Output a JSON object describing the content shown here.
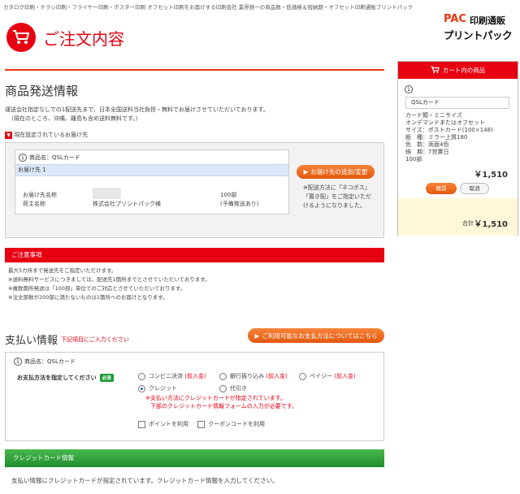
{
  "header": {
    "topline": "カタログ印刷・チラシ印刷・フライヤー印刷・ポスター印刷 オフセット印刷をお届けする印刷会社 業界随一の商品数・低価格＆短納期・オフセット印刷通販プリントパック",
    "logo_text1": "PAC",
    "logo_text2": "印刷通販",
    "logo_text3": "プリントパック",
    "page_title": "ご注文内容"
  },
  "shipping": {
    "heading": "商品発送情報",
    "desc1": "運送会社指定なしでの1配送先まで、日本全国送料当社負担・無料でお届けさせていただいております。",
    "desc2": "（現在のところ、沖縄、離島も含め送料無料です。）",
    "current_label": "現在設定されているお届け先",
    "item_num": "1",
    "item_name": "商品名：QSLカード",
    "dest_label": "お届け先 1",
    "recipient_label": "お届け先名称",
    "shipper_label": "荷主名称",
    "shipper_value": "株式会社プリントパック様",
    "qty": "100部",
    "qty_note": "(予備発送あり)",
    "add_button": "お届け先の追加/変更",
    "side_note1": "※配送方法に「ネコポス」",
    "side_note2": "「置き配」をご指定いただ",
    "side_note3": "けるようになりました。"
  },
  "notice": {
    "bar": "ご注意事項",
    "lines": [
      "最大5カ所まで発送先をご指定いただけます。",
      "※送料無料サービスにつきましては、配送先1箇所までとさせていただいております。",
      "※複数箇所発送は「100部」単位でのご対応とさせていただいております。",
      "※注文部数が200部に満たないものは1箇所へのお届けとなります。"
    ]
  },
  "payment": {
    "heading": "支払い情報",
    "required_note": "下記項目にご入力ください",
    "info_button": "ご利用可能なお支払方法についてはこちら",
    "item_num": "1",
    "item_name": "商品名：QSLカード",
    "prompt": "お支払方法を指定してください",
    "required_badge": "必須",
    "options": {
      "conveni": "コンビニ決済",
      "bank": "銀行振り込み",
      "paidy": "ペイジー",
      "credit": "クレジット",
      "cod": "代引き",
      "prepay": "(前入金)"
    },
    "selected": "クレジット",
    "credit_note1": "※支払い方法にクレジットカードが指定されています。",
    "credit_note2": "下部のクレジットカード情報フォームの入力が必要です。",
    "use_points": "ポイントを利用",
    "use_coupon": "クーポンコードを利用"
  },
  "credit": {
    "bar": "クレジットカード情報",
    "message": "支払い情報にクレジットカードが指定されています。クレジットカード情報を入力してください。"
  },
  "cart": {
    "title": "カート内の商品",
    "item_num": "1",
    "product": "QSLカード",
    "specs": [
      "カード類・ミニサイズ",
      "オンデマンドまたはオフセット",
      "サイズ：ポストカード(100×148)",
      "紙　種：ミラー上質180",
      "色　数：両面4色",
      "納　期：7営業日",
      "100部"
    ],
    "price": "￥1,510",
    "confirm_button": "確認",
    "cancel_button": "取消",
    "total_label": "合計",
    "total": "￥1,510"
  },
  "colors": {
    "accent_red": "#e60012",
    "orange": "#e8580d",
    "green": "#1f8d2f"
  }
}
